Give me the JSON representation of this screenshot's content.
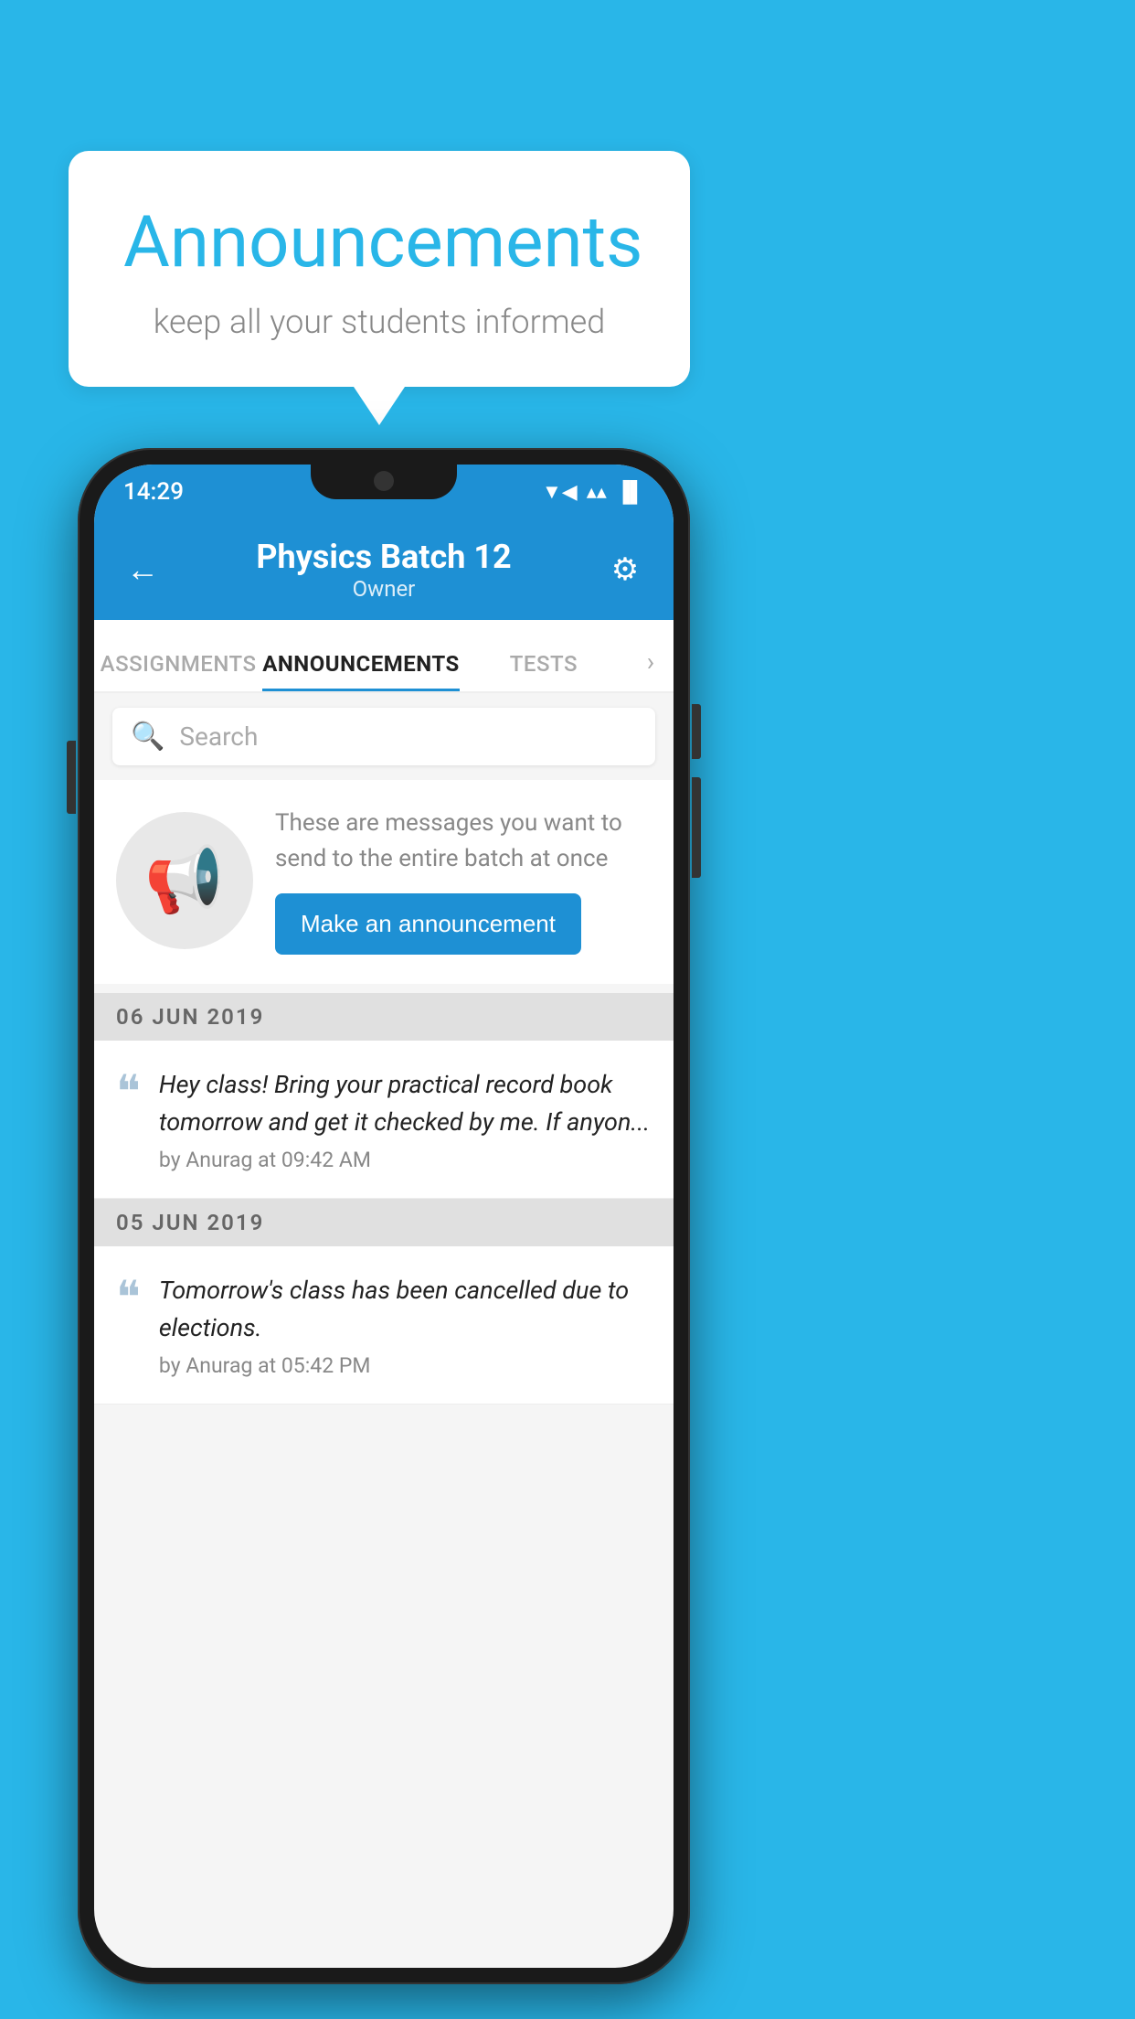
{
  "background_color": "#29b6e8",
  "speech_bubble": {
    "title": "Announcements",
    "subtitle": "keep all your students informed"
  },
  "phone": {
    "status_bar": {
      "time": "14:29",
      "wifi": "▼",
      "signal": "▲",
      "battery": "▐"
    },
    "app_bar": {
      "back_label": "←",
      "title": "Physics Batch 12",
      "subtitle": "Owner",
      "settings_label": "⚙"
    },
    "tabs": [
      {
        "label": "ASSIGNMENTS",
        "active": false
      },
      {
        "label": "ANNOUNCEMENTS",
        "active": true
      },
      {
        "label": "TESTS",
        "active": false
      },
      {
        "label": "›",
        "active": false
      }
    ],
    "search": {
      "placeholder": "Search"
    },
    "intro_card": {
      "description": "These are messages you want to send to the entire batch at once",
      "button_label": "Make an announcement"
    },
    "announcements": [
      {
        "date": "06  JUN  2019",
        "text": "Hey class! Bring your practical record book tomorrow and get it checked by me. If anyon...",
        "meta": "by Anurag at 09:42 AM"
      },
      {
        "date": "05  JUN  2019",
        "text": "Tomorrow's class has been cancelled due to elections.",
        "meta": "by Anurag at 05:42 PM"
      }
    ]
  }
}
